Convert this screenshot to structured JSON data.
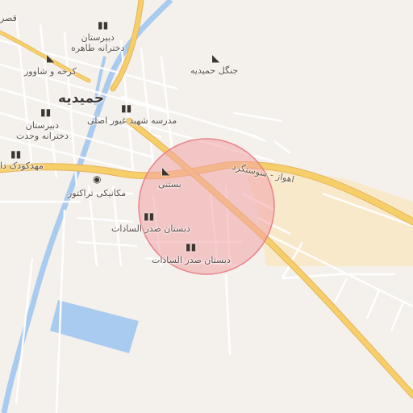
{
  "colors": {
    "background": "#f4f1ec",
    "water": "#aacbf0",
    "main_road": "#f6cf6a",
    "main_road_casing": "#e5b45a",
    "minor_road": "#ffffff",
    "marker_fill": "#f2a2a8",
    "marker_stroke": "#e8828a",
    "highlight_area": "#fbe6c0"
  },
  "labels": {
    "town": "حمیدیه",
    "highway": "اهواز - سوسنگرد",
    "school_top": "دبیرستان\nدخترانه طاهره",
    "shop_karkhe": "کرخه و شاوور",
    "jangal": "جنگل حمیدیه",
    "school_ghour": "مدرسه شهید غیور اصلی",
    "school_vahdat": "دبیرستان\nدخترانه وحدت",
    "kindergarten": "مهدکودک دا",
    "tractor": "مکانیکی تراکتور",
    "pastry": "بستنی",
    "sadr1": "دبستان صدر السادات",
    "sadr2": "دبستان صدر السادات",
    "ghasr": "قصر"
  },
  "icons": {
    "school": "school-icon",
    "shop": "shopping-basket-icon",
    "mechanic": "car-repair-icon",
    "marker": "location-radius-circle"
  }
}
